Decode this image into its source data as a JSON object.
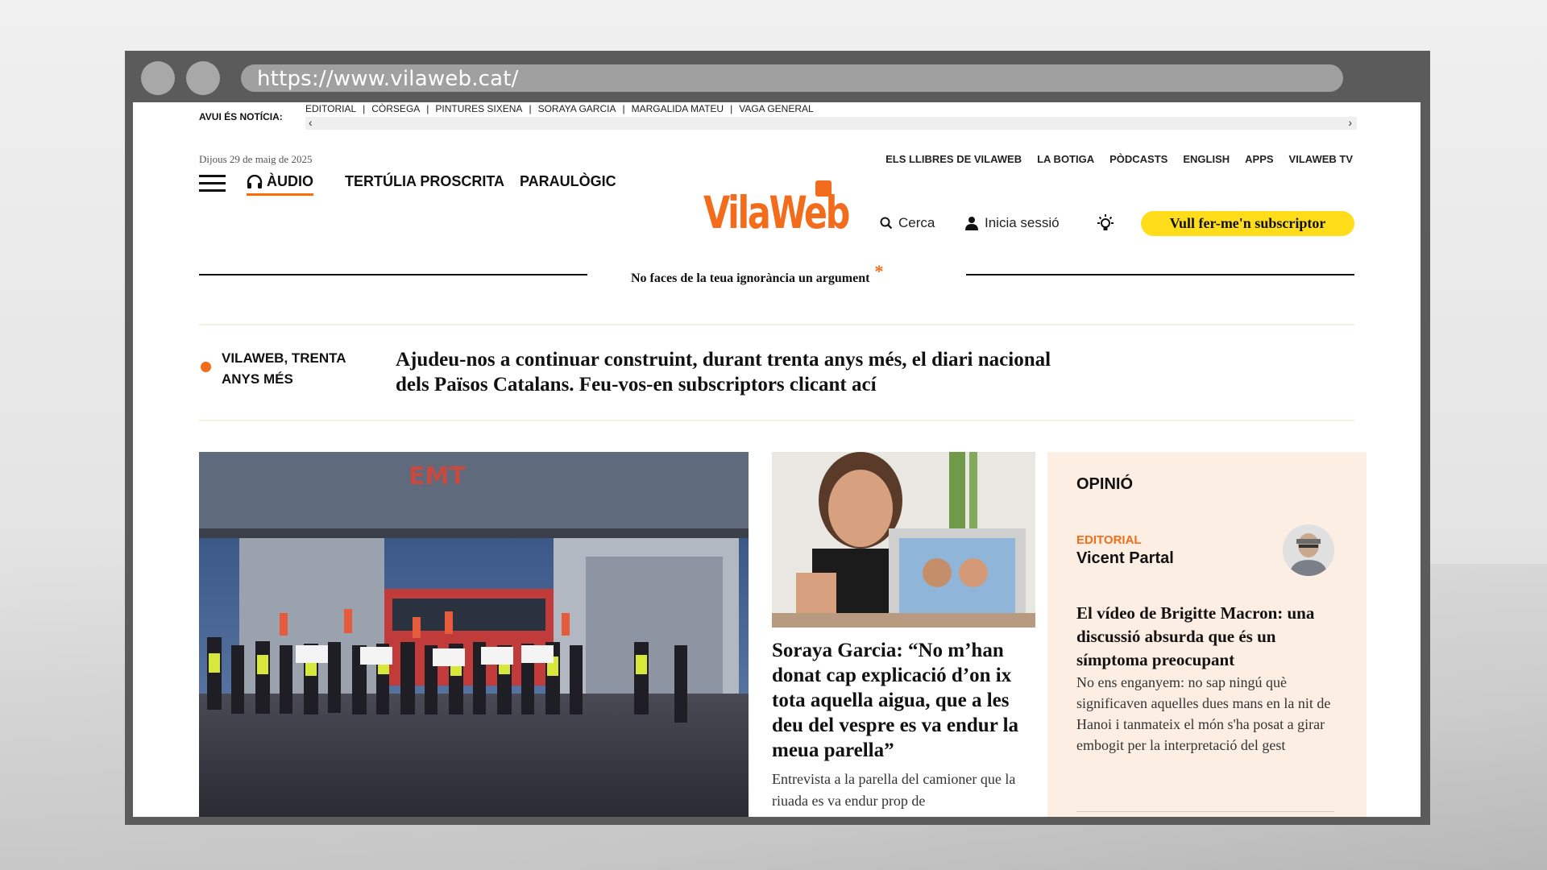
{
  "browser": {
    "url": "https://www.vilaweb.cat/"
  },
  "ticker": {
    "label": "AVUI ÉS NOTÍCIA:",
    "items": [
      "EDITORIAL",
      "CÒRSEGA",
      "PINTURES SIXENA",
      "SORAYA GARCIA",
      "MARGALIDA MATEU",
      "VAGA GENERAL"
    ],
    "separator": "|",
    "left_arrow": "‹",
    "right_arrow": "›"
  },
  "header": {
    "date": "Dijous 29 de maig de 2025",
    "top_links": [
      "ELS LLIBRES DE VILAWEB",
      "LA BOTIGA",
      "PÒDCASTS",
      "ENGLISH",
      "APPS",
      "VILAWEB TV"
    ],
    "nav": {
      "audio": "ÀUDIO",
      "tertulia": "TERTÚLIA PROSCRITA",
      "paraulogic": "PARAULÒGIC"
    },
    "logo": "VilaWeb",
    "search": "Cerca",
    "login": "Inicia sessió",
    "subscribe": "Vull fer-me'n subscriptor",
    "tagline": "No faces de la teua ignorància un argument",
    "tagline_mark": "*"
  },
  "promo": {
    "label": "VILAWEB, TRENTA ANYS MÉS",
    "text": "Ajudeu-nos a continuar construint, durant trenta anys més, el diari nacional dels Països Catalans. Feu-vos-en subscriptors clicant ací"
  },
  "main_story": {
    "image_sign": "EMT"
  },
  "side_story": {
    "headline": "Soraya Garcia: “No m’han donat cap explicació d’on ix tota aquella aigua, que a les deu del vespre es va endur la meua parella”",
    "summary": "Entrevista a la parella del camioner que la riuada es va endur prop de"
  },
  "opinion": {
    "section_title": "OPINIÓ",
    "kicker": "EDITORIAL",
    "author": "Vicent Partal",
    "headline": "El vídeo de Brigitte Macron: una discussió absurda que és un símptoma preocupant",
    "summary": "No ens enganyem: no sap ningú què significaven aquelles dues mans en la nit de Hanoi i tanmateix el món s'ha posat a girar embogit per la interpretació del gest"
  },
  "colors": {
    "brand_orange": "#f26c1c",
    "subscribe_yellow": "#ffdd1a",
    "opinion_bg": "#fdeee4"
  }
}
